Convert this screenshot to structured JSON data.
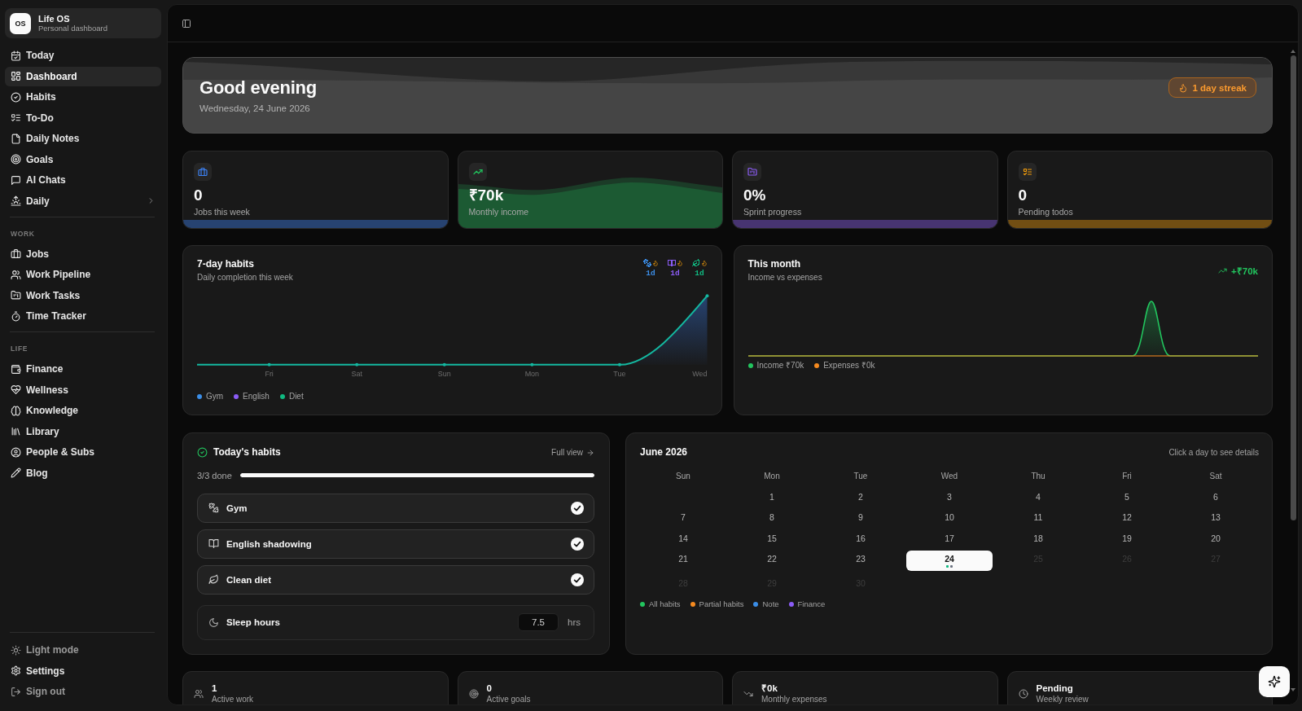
{
  "sidebar": {
    "logo": "OS",
    "app_name": "Life OS",
    "tagline": "Personal dashboard",
    "nav": [
      {
        "label": "Today",
        "selected": false,
        "submenu": false
      },
      {
        "label": "Dashboard",
        "selected": true,
        "submenu": false
      },
      {
        "label": "Habits",
        "selected": false,
        "submenu": false
      },
      {
        "label": "To-Do",
        "selected": false,
        "submenu": false
      },
      {
        "label": "Daily Notes",
        "selected": false,
        "submenu": false
      },
      {
        "label": "Goals",
        "selected": false,
        "submenu": false
      },
      {
        "label": "AI Chats",
        "selected": false,
        "submenu": false
      },
      {
        "label": "Daily",
        "selected": false,
        "submenu": true
      }
    ],
    "sections": [
      {
        "heading": "WORK",
        "items": [
          {
            "label": "Jobs",
            "selected": false
          },
          {
            "label": "Work Pipeline",
            "selected": false
          },
          {
            "label": "Work Tasks",
            "selected": false
          },
          {
            "label": "Time Tracker",
            "selected": false
          }
        ]
      },
      {
        "heading": "LIFE",
        "items": [
          {
            "label": "Finance",
            "selected": false
          },
          {
            "label": "Wellness",
            "selected": false
          },
          {
            "label": "Knowledge",
            "selected": false
          },
          {
            "label": "Library",
            "selected": false
          },
          {
            "label": "People & Subs",
            "selected": false
          },
          {
            "label": "Blog",
            "selected": false
          }
        ]
      }
    ],
    "footer": [
      {
        "label": "Light mode",
        "muted": true
      },
      {
        "label": "Settings",
        "muted": false
      },
      {
        "label": "Sign out",
        "muted": true
      }
    ]
  },
  "hero": {
    "greeting": "Good evening",
    "date": "Wednesday, 24 June 2026",
    "streak": "1 day streak"
  },
  "stats": [
    {
      "value": "0",
      "label": "Jobs this week",
      "color": "#274371",
      "kind": "bar"
    },
    {
      "value": "₹70k",
      "label": "Monthly income",
      "color": "#1c5a33",
      "kind": "wave"
    },
    {
      "value": "0%",
      "label": "Sprint progress",
      "color": "#473471",
      "kind": "bar"
    },
    {
      "value": "0",
      "label": "Pending todos",
      "color": "#714e13",
      "kind": "bar"
    }
  ],
  "habits_chart": {
    "title": "7-day habits",
    "subtitle": "Daily completion this week",
    "streaks": [
      {
        "value": "1d",
        "color": "#3b8ee8"
      },
      {
        "value": "1d",
        "color": "#8b5cf6"
      },
      {
        "value": "1d",
        "color": "#10b981"
      }
    ],
    "x_labels": [
      "Fri",
      "Sat",
      "Sun",
      "Mon",
      "Tue",
      "Wed"
    ],
    "legend": [
      {
        "label": "Gym",
        "color": "#3b8ee8"
      },
      {
        "label": "English",
        "color": "#8b5cf6"
      },
      {
        "label": "Diet",
        "color": "#10b981"
      }
    ]
  },
  "month_chart": {
    "title": "This month",
    "subtitle": "Income vs expenses",
    "net": "+₹70k",
    "legend": [
      {
        "label": "Income ₹70k",
        "color": "#22c55e"
      },
      {
        "label": "Expenses ₹0k",
        "color": "#f58a1f"
      }
    ]
  },
  "today": {
    "title": "Today's habits",
    "link": "Full view",
    "progress": {
      "label": "3/3 done",
      "level": 1
    },
    "habits": [
      {
        "name": "Gym",
        "checked": true
      },
      {
        "name": "English shadowing",
        "checked": true
      },
      {
        "name": "Clean diet",
        "checked": true
      }
    ],
    "sleep": {
      "label": "Sleep hours",
      "value": "7.5",
      "unit": "hrs"
    }
  },
  "calendar": {
    "title": "June 2026",
    "hint": "Click a day to see details",
    "weekdays": [
      "Sun",
      "Mon",
      "Tue",
      "Wed",
      "Thu",
      "Fri",
      "Sat"
    ],
    "weeks": [
      {
        "days": [
          {
            "label": "1",
            "selected": false,
            "muted": false
          },
          {
            "label": "2",
            "selected": false,
            "muted": false
          },
          {
            "label": "3",
            "selected": false,
            "muted": false
          },
          {
            "label": "4",
            "selected": false,
            "muted": false
          },
          {
            "label": "5",
            "selected": false,
            "muted": false
          },
          {
            "label": "6",
            "selected": false,
            "muted": false
          }
        ]
      },
      {
        "days": [
          {
            "label": "7",
            "selected": false,
            "muted": false
          },
          {
            "label": "8",
            "selected": false,
            "muted": false
          },
          {
            "label": "9",
            "selected": false,
            "muted": false
          },
          {
            "label": "10",
            "selected": false,
            "muted": false
          },
          {
            "label": "11",
            "selected": false,
            "muted": false
          },
          {
            "label": "12",
            "selected": false,
            "muted": false
          },
          {
            "label": "13",
            "selected": false,
            "muted": false
          }
        ]
      },
      {
        "days": [
          {
            "label": "14",
            "selected": false,
            "muted": false
          },
          {
            "label": "15",
            "selected": false,
            "muted": false
          },
          {
            "label": "16",
            "selected": false,
            "muted": false
          },
          {
            "label": "17",
            "selected": false,
            "muted": false
          },
          {
            "label": "18",
            "selected": false,
            "muted": false
          },
          {
            "label": "19",
            "selected": false,
            "muted": false
          },
          {
            "label": "20",
            "selected": false,
            "muted": false
          }
        ]
      },
      {
        "days": [
          {
            "label": "21",
            "selected": false,
            "muted": false
          },
          {
            "label": "22",
            "selected": false,
            "muted": false
          },
          {
            "label": "23",
            "selected": false,
            "muted": false
          },
          {
            "label": "24",
            "selected": true,
            "muted": false,
            "dots": [
              {
                "color": "#10b981"
              },
              {
                "color": "#6b7280"
              }
            ]
          },
          {
            "label": "25",
            "selected": false,
            "muted": true
          },
          {
            "label": "26",
            "selected": false,
            "muted": true
          },
          {
            "label": "27",
            "selected": false,
            "muted": true
          }
        ]
      },
      {
        "days": [
          {
            "label": "28",
            "selected": false,
            "muted": true
          },
          {
            "label": "29",
            "selected": false,
            "muted": true
          },
          {
            "label": "30",
            "selected": false,
            "muted": true
          }
        ]
      }
    ],
    "legend": [
      {
        "label": "All habits",
        "color": "#22c55e"
      },
      {
        "label": "Partial habits",
        "color": "#f58a1f"
      },
      {
        "label": "Note",
        "color": "#3b8ee8"
      },
      {
        "label": "Finance",
        "color": "#8b5cf6"
      }
    ]
  },
  "summary": [
    {
      "value": "1",
      "label": "Active work"
    },
    {
      "value": "0",
      "label": "Active goals"
    },
    {
      "value": "₹0k",
      "label": "Monthly expenses"
    },
    {
      "value": "Pending",
      "label": "Weekly review"
    }
  ]
}
